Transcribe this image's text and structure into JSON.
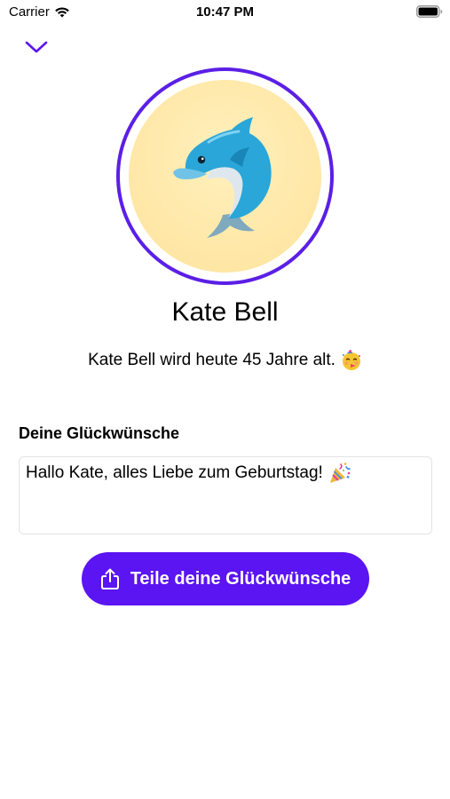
{
  "status_bar": {
    "carrier": "Carrier",
    "time": "10:47 PM",
    "wifi_icon": "wifi-icon",
    "battery_icon": "battery-icon"
  },
  "header": {
    "dismiss_icon": "chevron-down-icon"
  },
  "avatar": {
    "emoji": "dolphin-icon"
  },
  "contact": {
    "name": "Kate Bell",
    "birthday_text": "Kate Bell wird heute 45 Jahre alt.",
    "birthday_emoji": "partying-face-icon"
  },
  "wishes": {
    "label": "Deine Glückwünsche",
    "message": "Hallo Kate, alles Liebe zum Geburtstag!",
    "message_emoji": "party-popper-icon"
  },
  "share_button": {
    "label": "Teile deine Glückwünsche",
    "icon": "share-icon"
  },
  "colors": {
    "accent": "#5b14f2",
    "avatar_ring": "#5b1fe6",
    "avatar_background": "#ffe8a8"
  }
}
